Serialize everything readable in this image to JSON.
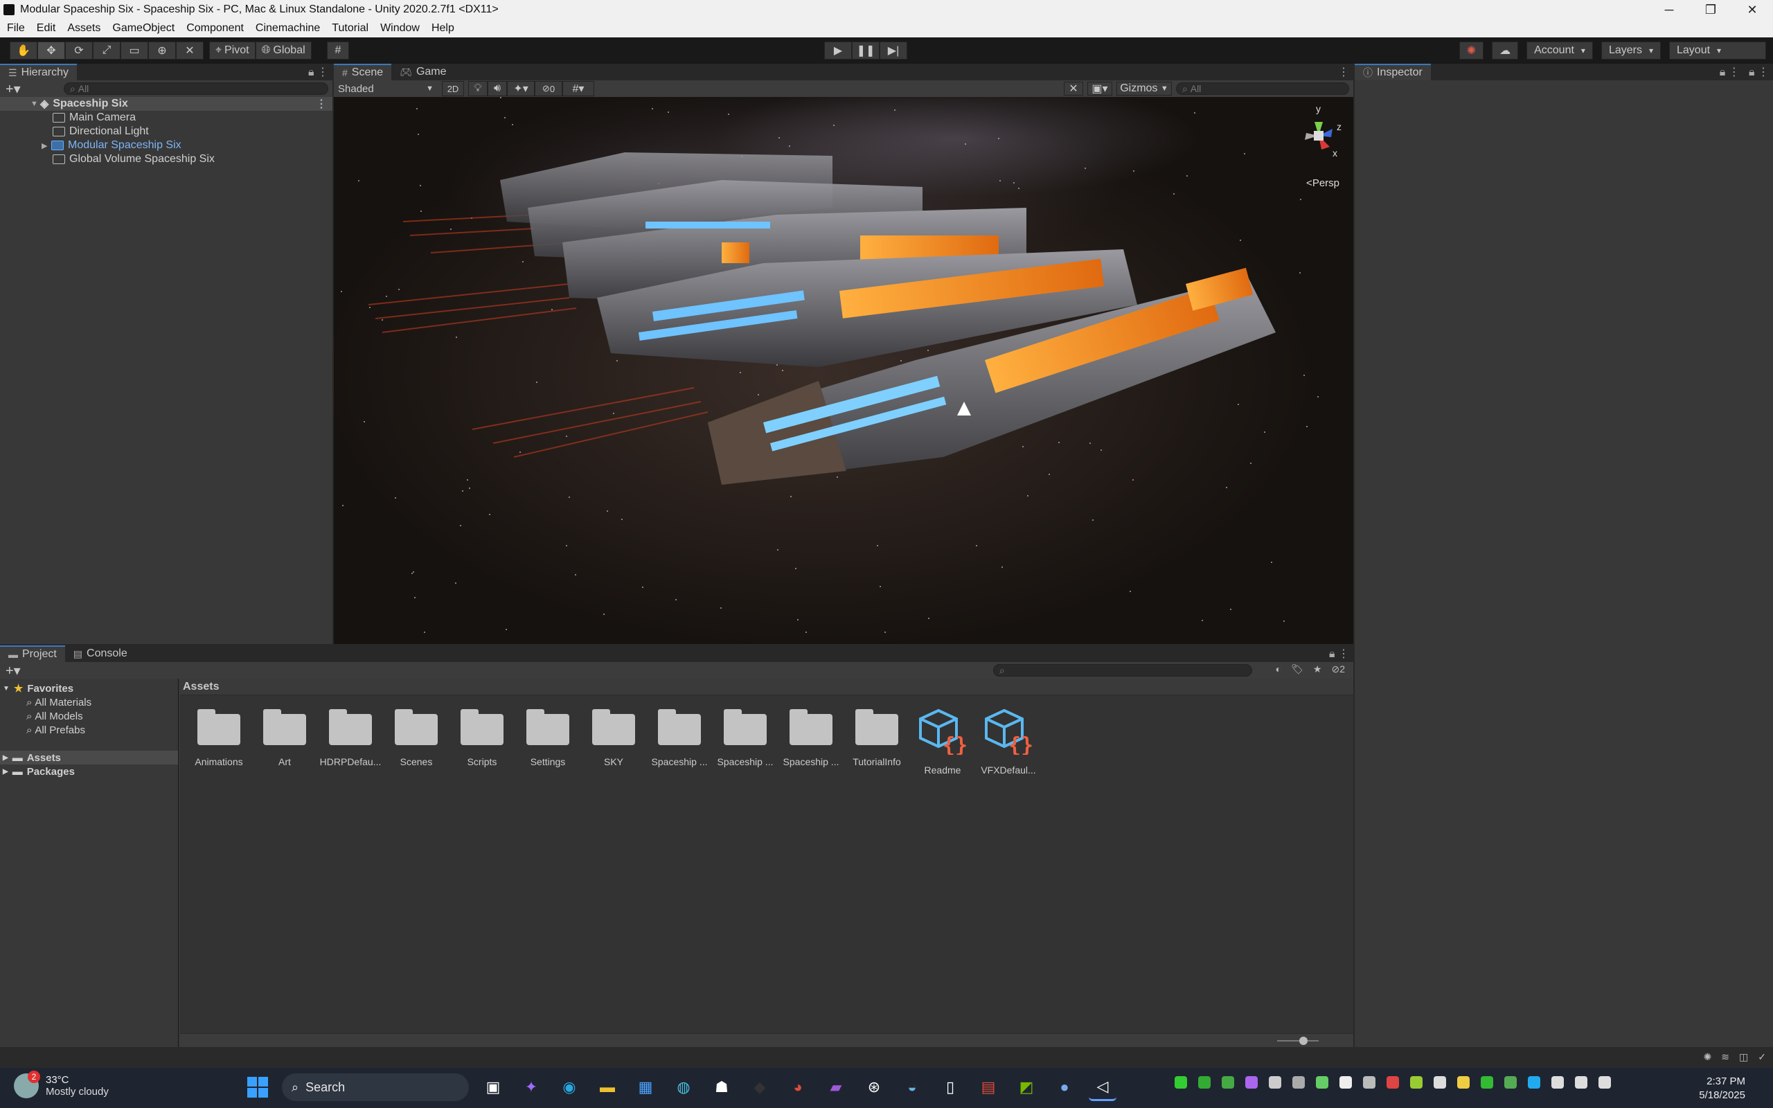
{
  "window": {
    "title": "Modular Spaceship Six - Spaceship Six - PC, Mac & Linux Standalone - Unity 2020.2.7f1 <DX11>",
    "controls": [
      "─",
      "❐",
      "✕"
    ]
  },
  "menu": [
    "File",
    "Edit",
    "Assets",
    "GameObject",
    "Component",
    "Cinemachine",
    "Tutorial",
    "Window",
    "Help"
  ],
  "toolbar": {
    "pivot_label": "Pivot",
    "global_label": "Global",
    "account_label": "Account",
    "layers_label": "Layers",
    "layout_label": "Layout"
  },
  "hierarchy": {
    "tab_label": "Hierarchy",
    "search_placeholder": "All",
    "scene_name": "Spaceship Six",
    "items": [
      "Main Camera",
      "Directional Light",
      "Modular Spaceship Six",
      "Global Volume Spaceship Six"
    ]
  },
  "scene_view": {
    "tabs": [
      "Scene",
      "Game"
    ],
    "draw_mode": "Shaded",
    "mode_2d": "2D",
    "hidden_count": "0",
    "gizmos_label": "Gizmos",
    "search_placeholder": "All",
    "persp_label": "Persp",
    "axes": {
      "y": "y",
      "z": "z",
      "x": "x"
    }
  },
  "project": {
    "tabs": [
      "Project",
      "Console"
    ],
    "hidden_count": "2",
    "favorites_label": "Favorites",
    "favorites": [
      "All Materials",
      "All Models",
      "All Prefabs"
    ],
    "roots": [
      "Assets",
      "Packages"
    ],
    "breadcrumb": "Assets",
    "assets": [
      {
        "name": "Animations",
        "type": "folder"
      },
      {
        "name": "Art",
        "type": "folder"
      },
      {
        "name": "HDRPDefau...",
        "type": "folder"
      },
      {
        "name": "Scenes",
        "type": "folder"
      },
      {
        "name": "Scripts",
        "type": "folder"
      },
      {
        "name": "Settings",
        "type": "folder"
      },
      {
        "name": "SKY",
        "type": "folder"
      },
      {
        "name": "Spaceship ...",
        "type": "folder"
      },
      {
        "name": "Spaceship ...",
        "type": "folder"
      },
      {
        "name": "Spaceship ...",
        "type": "folder"
      },
      {
        "name": "TutorialInfo",
        "type": "folder"
      },
      {
        "name": "Readme",
        "type": "script"
      },
      {
        "name": "VFXDefaul...",
        "type": "script"
      }
    ]
  },
  "inspector": {
    "tab_label": "Inspector"
  },
  "taskbar": {
    "weather_temp": "33°C",
    "weather_desc": "Mostly cloudy",
    "weather_badge": "2",
    "search_label": "Search",
    "time": "2:37 PM",
    "date": "5/18/2025"
  },
  "colors": {
    "accent": "#3a79bb",
    "selected_text": "#7db5f7",
    "panel": "#383838"
  }
}
